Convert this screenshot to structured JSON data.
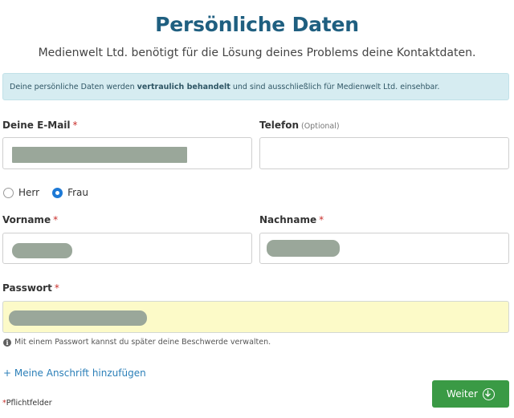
{
  "header": {
    "title": "Persönliche Daten",
    "subtitle": "Medienwelt Ltd. benötigt für die Lösung deines Problems deine Kontaktdaten."
  },
  "info": {
    "part1": "Deine persönliche Daten werden ",
    "bold": "vertraulich behandelt",
    "part2": " und sind ausschließlich für Medienwelt Ltd. einsehbar."
  },
  "form": {
    "email": {
      "label": "Deine E-Mail",
      "required": "*"
    },
    "phone": {
      "label": "Telefon",
      "optional": "(Optional)"
    },
    "salutation": {
      "options": [
        "Herr",
        "Frau"
      ],
      "selected": "Frau"
    },
    "firstname": {
      "label": "Vorname",
      "required": "*"
    },
    "lastname": {
      "label": "Nachname",
      "required": "*"
    },
    "password": {
      "label": "Passwort",
      "required": "*",
      "hint": "Mit einem Passwort kannst du später deine Beschwerde verwalten."
    },
    "add_address": "+ Meine Anschrift hinzufügen",
    "required_note": "Pflichtfelder",
    "required_mark": "*",
    "submit": "Weiter"
  },
  "icons": {
    "hint": "info-icon",
    "submit": "arrow-down-circle-icon"
  },
  "colors": {
    "title": "#1f5f80",
    "info_bg": "#d6ecf1",
    "button": "#3a9a45",
    "link": "#2b7fb8",
    "required": "#c9302c",
    "highlight": "#fcfac8"
  }
}
